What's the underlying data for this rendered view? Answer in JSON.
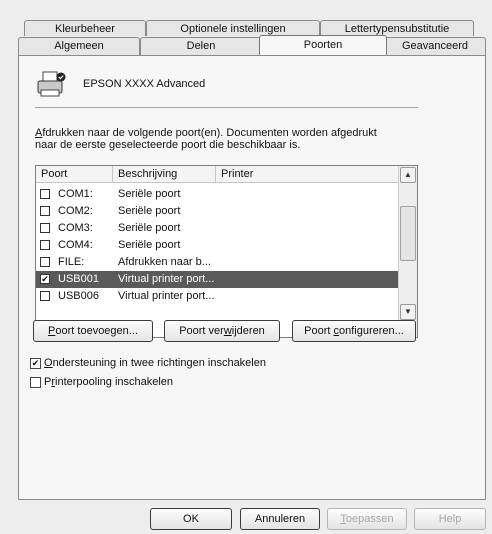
{
  "tabs_back": [
    "Kleurbeheer",
    "Optionele instellingen",
    "Lettertypensubstitutie"
  ],
  "tabs_front": [
    "Algemeen",
    "Delen",
    "Poorten",
    "Geavanceerd"
  ],
  "active_tab": "Poorten",
  "printer_name": "EPSON XXXX Advanced",
  "description": {
    "line1_prefix": "A",
    "line1_rest": "fdrukken naar de volgende poort(en). Documenten worden afgedrukt",
    "line2": "naar de eerste geselecteerde poort die beschikbaar is."
  },
  "port_list": {
    "columns": [
      "Poort",
      "Beschrijving",
      "Printer"
    ],
    "rows": [
      {
        "checked": false,
        "port": "COM1:",
        "description": "Seriële poort",
        "printer": ""
      },
      {
        "checked": false,
        "port": "COM2:",
        "description": "Seriële poort",
        "printer": ""
      },
      {
        "checked": false,
        "port": "COM3:",
        "description": "Seriële poort",
        "printer": ""
      },
      {
        "checked": false,
        "port": "COM4:",
        "description": "Seriële poort",
        "printer": ""
      },
      {
        "checked": false,
        "port": "FILE:",
        "description": "Afdrukken naar b...",
        "printer": ""
      },
      {
        "checked": true,
        "port": "USB001",
        "description": "Virtual printer port...",
        "printer": "",
        "selected": true
      },
      {
        "checked": false,
        "port": "USB006",
        "description": "Virtual printer port...",
        "printer": ""
      }
    ]
  },
  "port_buttons": {
    "add": {
      "prefix": "",
      "accel": "P",
      "rest": "oort toevoegen..."
    },
    "remove": {
      "prefix": "Poort ver",
      "accel": "w",
      "rest": "ijderen"
    },
    "configure": {
      "prefix": "Poort ",
      "accel": "c",
      "rest": "onfigureren..."
    }
  },
  "options": {
    "bidirectional": {
      "accel": "O",
      "rest": "ndersteuning in twee richtingen inschakelen",
      "checked": true
    },
    "pooling": {
      "prefix": "P",
      "accel": "r",
      "rest": "interpooling inschakelen",
      "checked": false
    }
  },
  "dialog_buttons": {
    "ok": "OK",
    "cancel": "Annuleren",
    "apply": {
      "accel": "T",
      "rest": "oepassen",
      "disabled": true
    },
    "help": {
      "label": "Help",
      "disabled": true
    }
  },
  "icons": {
    "printer": "printer-icon",
    "scroll_up": "chevron-up-icon",
    "scroll_down": "chevron-down-icon",
    "check": "checkmark-icon"
  },
  "colors": {
    "selected_row": "#5a5a5a",
    "dialog_bg": "#ededed",
    "panel_bg": "#f7f7f7"
  }
}
